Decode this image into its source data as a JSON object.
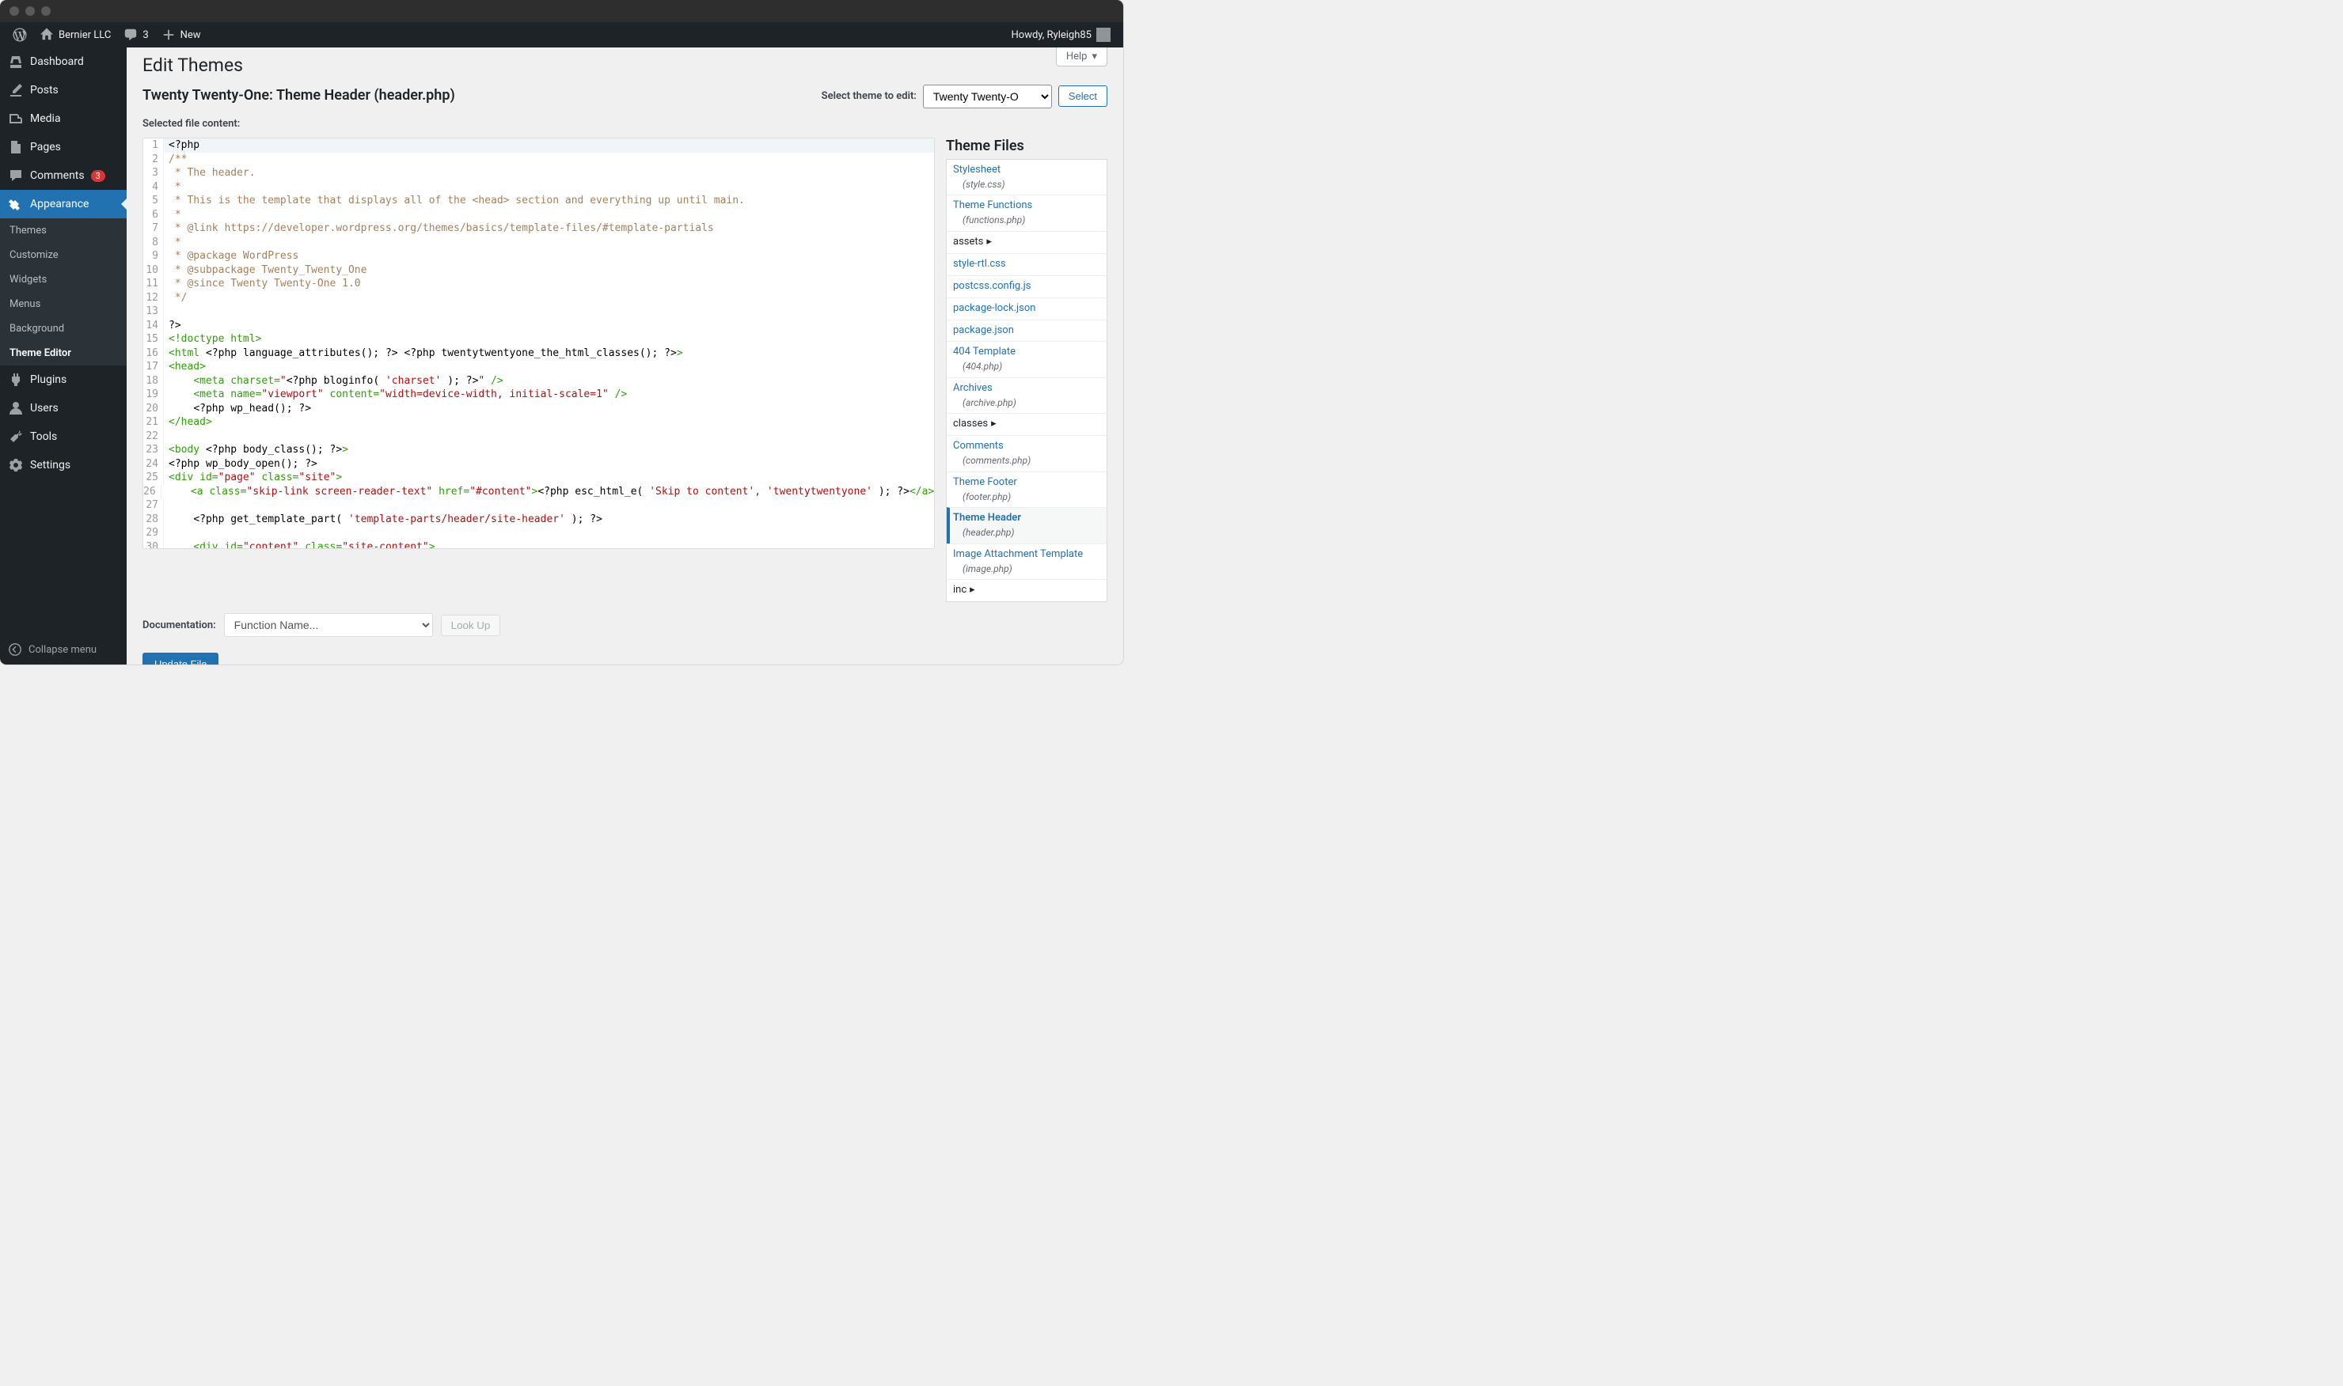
{
  "adminbar": {
    "site_name": "Bernier LLC",
    "comment_count": "3",
    "new_label": "New",
    "howdy": "Howdy, Ryleigh85"
  },
  "sidebar": {
    "items": [
      {
        "id": "dashboard",
        "label": "Dashboard"
      },
      {
        "id": "posts",
        "label": "Posts"
      },
      {
        "id": "media",
        "label": "Media"
      },
      {
        "id": "pages",
        "label": "Pages"
      },
      {
        "id": "comments",
        "label": "Comments",
        "badge": "3"
      },
      {
        "id": "appearance",
        "label": "Appearance"
      },
      {
        "id": "plugins",
        "label": "Plugins"
      },
      {
        "id": "users",
        "label": "Users"
      },
      {
        "id": "tools",
        "label": "Tools"
      },
      {
        "id": "settings",
        "label": "Settings"
      }
    ],
    "appearance_sub": [
      "Themes",
      "Customize",
      "Widgets",
      "Menus",
      "Background",
      "Theme Editor"
    ],
    "collapse_label": "Collapse menu"
  },
  "page": {
    "help_label": "Help",
    "title": "Edit Themes",
    "theme_heading": "Twenty Twenty-One: Theme Header (header.php)",
    "select_label": "Select theme to edit:",
    "theme_option": "Twenty Twenty-O",
    "select_btn": "Select",
    "content_label": "Selected file content:",
    "doc_label": "Documentation:",
    "doc_placeholder": "Function Name...",
    "lookup_label": "Look Up",
    "update_label": "Update File",
    "files_heading": "Theme Files"
  },
  "code_lines": [
    {
      "n": 1,
      "hl": true,
      "html": "<span class='c-php'>&lt;?php</span>"
    },
    {
      "n": 2,
      "html": "<span class='c-cm'>/**</span>"
    },
    {
      "n": 3,
      "html": "<span class='c-cm'> * The header.</span>"
    },
    {
      "n": 4,
      "html": "<span class='c-cm'> *</span>"
    },
    {
      "n": 5,
      "html": "<span class='c-cm'> * This is the template that displays all of the &lt;head&gt; section and everything up until main.</span>"
    },
    {
      "n": 6,
      "html": "<span class='c-cm'> *</span>"
    },
    {
      "n": 7,
      "html": "<span class='c-cm'> * @link https://developer.wordpress.org/themes/basics/template-files/#template-partials</span>"
    },
    {
      "n": 8,
      "html": "<span class='c-cm'> *</span>"
    },
    {
      "n": 9,
      "html": "<span class='c-cm'> * @package WordPress</span>"
    },
    {
      "n": 10,
      "html": "<span class='c-cm'> * @subpackage Twenty_Twenty_One</span>"
    },
    {
      "n": 11,
      "html": "<span class='c-cm'> * @since Twenty Twenty-One 1.0</span>"
    },
    {
      "n": 12,
      "html": "<span class='c-cm'> */</span>"
    },
    {
      "n": 13,
      "html": ""
    },
    {
      "n": 14,
      "html": "<span class='c-php'>?&gt;</span>"
    },
    {
      "n": 15,
      "html": "<span class='c-tag'>&lt;!doctype html&gt;</span>"
    },
    {
      "n": 16,
      "html": "<span class='c-tag'>&lt;html </span><span class='c-php'>&lt;?php</span> <span class='c-fn'>language_attributes();</span> <span class='c-php'>?&gt;</span> <span class='c-php'>&lt;?php</span> <span class='c-fn'>twentytwentyone_the_html_classes();</span> <span class='c-php'>?&gt;</span><span class='c-tag'>&gt;</span>"
    },
    {
      "n": 17,
      "html": "<span class='c-tag'>&lt;head&gt;</span>"
    },
    {
      "n": 18,
      "html": "    <span class='c-tag'>&lt;meta</span> <span class='c-attr'>charset=</span><span class='c-str'>\"</span><span class='c-php'>&lt;?php</span> <span class='c-fn'>bloginfo(</span> <span class='c-str'>'charset'</span> <span class='c-fn'>);</span> <span class='c-php'>?&gt;</span><span class='c-str'>\"</span> <span class='c-tag'>/&gt;</span>"
    },
    {
      "n": 19,
      "html": "    <span class='c-tag'>&lt;meta</span> <span class='c-attr'>name=</span><span class='c-str'>\"viewport\"</span> <span class='c-attr'>content=</span><span class='c-str'>\"width=device-width, initial-scale=1\"</span> <span class='c-tag'>/&gt;</span>"
    },
    {
      "n": 20,
      "html": "    <span class='c-php'>&lt;?php</span> <span class='c-fn'>wp_head();</span> <span class='c-php'>?&gt;</span>"
    },
    {
      "n": 21,
      "html": "<span class='c-tag'>&lt;/head&gt;</span>"
    },
    {
      "n": 22,
      "html": ""
    },
    {
      "n": 23,
      "html": "<span class='c-tag'>&lt;body </span><span class='c-php'>&lt;?php</span> <span class='c-fn'>body_class();</span> <span class='c-php'>?&gt;</span><span class='c-tag'>&gt;</span>"
    },
    {
      "n": 24,
      "html": "<span class='c-php'>&lt;?php</span> <span class='c-fn'>wp_body_open();</span> <span class='c-php'>?&gt;</span>"
    },
    {
      "n": 25,
      "html": "<span class='c-tag'>&lt;div</span> <span class='c-attr'>id=</span><span class='c-str'>\"page\"</span> <span class='c-attr'>class=</span><span class='c-str'>\"site\"</span><span class='c-tag'>&gt;</span>"
    },
    {
      "n": 26,
      "html": "    <span class='c-tag'>&lt;a</span> <span class='c-attr'>class=</span><span class='c-str'>\"skip-link screen-reader-text\"</span> <span class='c-attr'>href=</span><span class='c-str'>\"#content\"</span><span class='c-tag'>&gt;</span><span class='c-php'>&lt;?php</span> <span class='c-fn'>esc_html_e(</span> <span class='c-str'>'Skip to content'</span>, <span class='c-str'>'twentytwentyone'</span> <span class='c-fn'>);</span> <span class='c-php'>?&gt;</span><span class='c-tag'>&lt;/a&gt;</span>"
    },
    {
      "n": 27,
      "html": ""
    },
    {
      "n": 28,
      "html": "    <span class='c-php'>&lt;?php</span> <span class='c-fn'>get_template_part(</span> <span class='c-str'>'template-parts/header/site-header'</span> <span class='c-fn'>);</span> <span class='c-php'>?&gt;</span>"
    },
    {
      "n": 29,
      "html": ""
    },
    {
      "n": 30,
      "html": "    <span class='c-tag'>&lt;div</span> <span class='c-attr'>id=</span><span class='c-str'>\"content\"</span> <span class='c-attr'>class=</span><span class='c-str'>\"site-content\"</span><span class='c-tag'>&gt;</span>"
    }
  ],
  "theme_files": [
    {
      "name": "Stylesheet",
      "sub": "(style.css)"
    },
    {
      "name": "Theme Functions",
      "sub": "(functions.php)"
    },
    {
      "name": "assets",
      "folder": true
    },
    {
      "name": "style-rtl.css"
    },
    {
      "name": "postcss.config.js"
    },
    {
      "name": "package-lock.json"
    },
    {
      "name": "package.json"
    },
    {
      "name": "404 Template",
      "sub": "(404.php)"
    },
    {
      "name": "Archives",
      "sub": "(archive.php)"
    },
    {
      "name": "classes",
      "folder": true
    },
    {
      "name": "Comments",
      "sub": "(comments.php)"
    },
    {
      "name": "Theme Footer",
      "sub": "(footer.php)"
    },
    {
      "name": "Theme Header",
      "sub": "(header.php)",
      "active": true
    },
    {
      "name": "Image Attachment Template",
      "sub": "(image.php)"
    },
    {
      "name": "inc",
      "folder": true
    }
  ]
}
